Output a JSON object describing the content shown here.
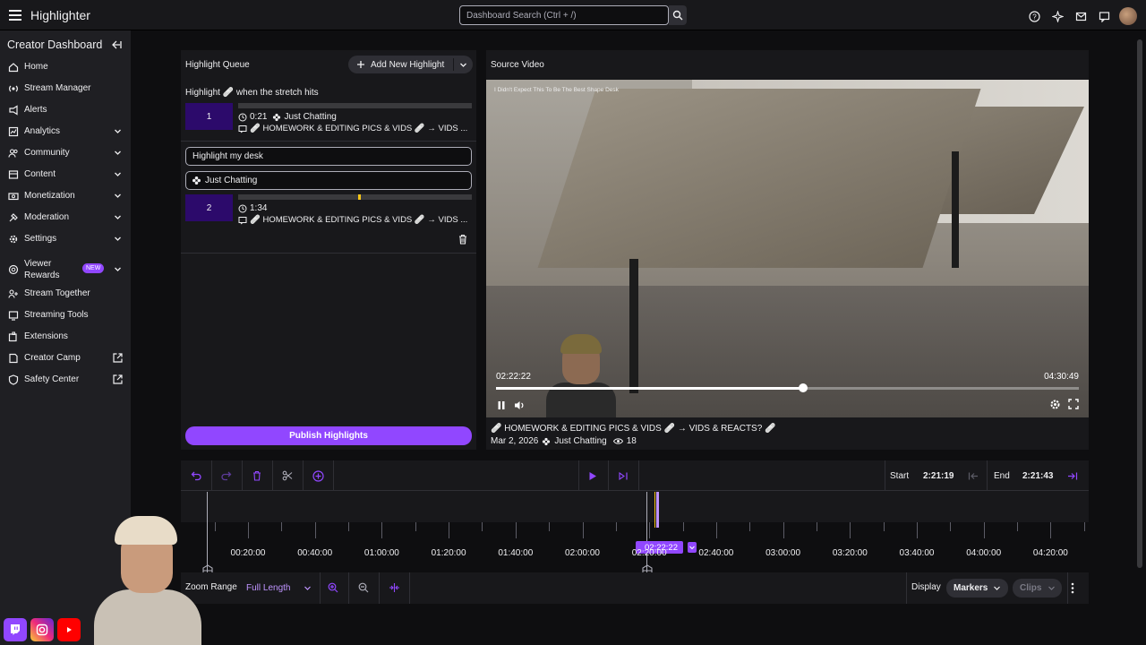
{
  "topbar": {
    "app_title": "Highlighter",
    "search_placeholder": "Dashboard Search (Ctrl + /)"
  },
  "sidebar": {
    "heading": "Creator Dashboard",
    "items": [
      {
        "label": "Home",
        "icon": "home-icon",
        "chevron": false
      },
      {
        "label": "Stream Manager",
        "icon": "stream-manager-icon",
        "chevron": false
      },
      {
        "label": "Alerts",
        "icon": "alerts-icon",
        "chevron": false
      },
      {
        "label": "Analytics",
        "icon": "analytics-icon",
        "chevron": true
      },
      {
        "label": "Community",
        "icon": "community-icon",
        "chevron": true
      },
      {
        "label": "Content",
        "icon": "content-icon",
        "chevron": true
      },
      {
        "label": "Monetization",
        "icon": "monetization-icon",
        "chevron": true
      },
      {
        "label": "Moderation",
        "icon": "moderation-icon",
        "chevron": true
      },
      {
        "label": "Settings",
        "icon": "settings-icon",
        "chevron": true
      },
      {
        "label": "Viewer",
        "label2": "Rewards",
        "icon": "rewards-icon",
        "chevron": true,
        "badge": "NEW"
      },
      {
        "label": "Stream Together",
        "icon": "stream-together-icon",
        "chevron": false
      },
      {
        "label": "Streaming Tools",
        "icon": "streaming-tools-icon",
        "chevron": false
      },
      {
        "label": "Extensions",
        "icon": "extensions-icon",
        "chevron": false
      },
      {
        "label": "Creator Camp",
        "icon": "creator-camp-icon",
        "external": true
      },
      {
        "label": "Safety Center",
        "icon": "safety-center-icon",
        "external": true
      }
    ]
  },
  "queue": {
    "title": "Highlight Queue",
    "add_button": "Add New Highlight",
    "highlight1": {
      "title": "Highlight 🩹 when the stretch hits",
      "number": "1",
      "duration": "0:21",
      "category": "Just Chatting",
      "stream_title": "🩹 HOMEWORK & EDITING PICS & VIDS 🩹 → VIDS ..."
    },
    "highlight2": {
      "title_value": "Highlight my desk",
      "category_value": "Just Chatting",
      "number": "2",
      "duration": "1:34",
      "stream_title": "🩹 HOMEWORK & EDITING PICS & VIDS 🩹 → VIDS ..."
    },
    "publish_button": "Publish Highlights"
  },
  "video": {
    "title": "Source Video",
    "caption": "I Didn't Expect This To Be The Best Shape Desk",
    "current_time": "02:22:22",
    "total_time": "04:30:49",
    "progress": 0.527,
    "stream_title": "🩹 HOMEWORK & EDITING PICS & VIDS 🩹 → VIDS & REACTS? 🩹",
    "date": "Mar 2, 2026",
    "category": "Just Chatting",
    "views": "18"
  },
  "timeline": {
    "start_label": "Start",
    "start_value": "2:21:19",
    "end_label": "End",
    "end_value": "2:21:43",
    "ticks": [
      "00:20:00",
      "00:40:00",
      "01:00:00",
      "01:20:00",
      "01:40:00",
      "02:00:00",
      "02:20:00",
      "02:40:00",
      "03:00:00",
      "03:20:00",
      "03:40:00",
      "04:00:00",
      "04:20:00"
    ],
    "playhead": "02:22:22",
    "zoom_label": "Zoom Range",
    "zoom_value": "Full Length",
    "display_label": "Display",
    "markers_label": "Markers",
    "clips_label": "Clips"
  },
  "accent_color": "#9147ff"
}
